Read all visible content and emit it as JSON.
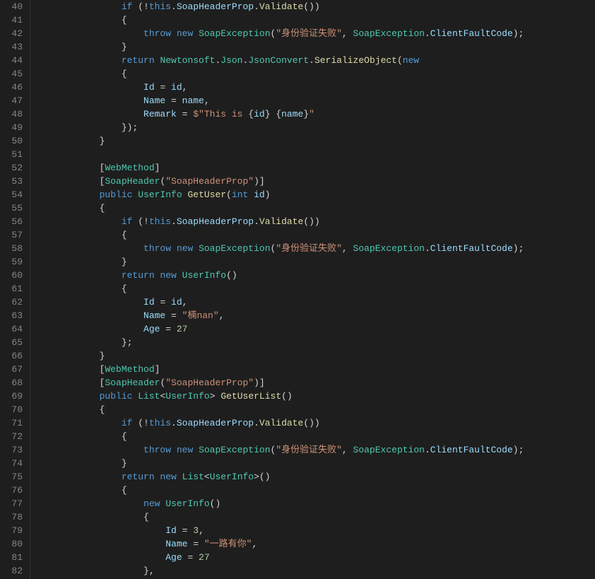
{
  "gutter": {
    "start": 40,
    "end": 82
  },
  "code": {
    "lines": [
      {
        "indent": 3,
        "segments": [
          {
            "c": "kw",
            "t": "if"
          },
          {
            "c": "pn",
            "t": " (!"
          },
          {
            "c": "kw",
            "t": "this"
          },
          {
            "c": "pn",
            "t": "."
          },
          {
            "c": "id",
            "t": "SoapHeaderProp"
          },
          {
            "c": "pn",
            "t": "."
          },
          {
            "c": "fn",
            "t": "Validate"
          },
          {
            "c": "pn",
            "t": "())"
          }
        ]
      },
      {
        "indent": 3,
        "segments": [
          {
            "c": "pn",
            "t": "{"
          }
        ]
      },
      {
        "indent": 4,
        "segments": [
          {
            "c": "kw",
            "t": "throw"
          },
          {
            "c": "pn",
            "t": " "
          },
          {
            "c": "kw",
            "t": "new"
          },
          {
            "c": "pn",
            "t": " "
          },
          {
            "c": "type",
            "t": "SoapException"
          },
          {
            "c": "pn",
            "t": "("
          },
          {
            "c": "str",
            "t": "\"身份验证失败\""
          },
          {
            "c": "pn",
            "t": ", "
          },
          {
            "c": "type",
            "t": "SoapException"
          },
          {
            "c": "pn",
            "t": "."
          },
          {
            "c": "id",
            "t": "ClientFaultCode"
          },
          {
            "c": "pn",
            "t": ");"
          }
        ]
      },
      {
        "indent": 3,
        "segments": [
          {
            "c": "pn",
            "t": "}"
          }
        ]
      },
      {
        "indent": 3,
        "segments": [
          {
            "c": "kw",
            "t": "return"
          },
          {
            "c": "pn",
            "t": " "
          },
          {
            "c": "type",
            "t": "Newtonsoft"
          },
          {
            "c": "pn",
            "t": "."
          },
          {
            "c": "type",
            "t": "Json"
          },
          {
            "c": "pn",
            "t": "."
          },
          {
            "c": "type",
            "t": "JsonConvert"
          },
          {
            "c": "pn",
            "t": "."
          },
          {
            "c": "fn",
            "t": "SerializeObject"
          },
          {
            "c": "pn",
            "t": "("
          },
          {
            "c": "kw",
            "t": "new"
          }
        ]
      },
      {
        "indent": 3,
        "segments": [
          {
            "c": "pn",
            "t": "{"
          }
        ]
      },
      {
        "indent": 4,
        "segments": [
          {
            "c": "id",
            "t": "Id"
          },
          {
            "c": "pn",
            "t": " = "
          },
          {
            "c": "id",
            "t": "id"
          },
          {
            "c": "pn",
            "t": ","
          }
        ]
      },
      {
        "indent": 4,
        "segments": [
          {
            "c": "id",
            "t": "Name"
          },
          {
            "c": "pn",
            "t": " = "
          },
          {
            "c": "id",
            "t": "name"
          },
          {
            "c": "pn",
            "t": ","
          }
        ]
      },
      {
        "indent": 4,
        "segments": [
          {
            "c": "id",
            "t": "Remark"
          },
          {
            "c": "pn",
            "t": " = "
          },
          {
            "c": "str",
            "t": "$\"This is "
          },
          {
            "c": "pn",
            "t": "{"
          },
          {
            "c": "id",
            "t": "id"
          },
          {
            "c": "pn",
            "t": "}"
          },
          {
            "c": "str",
            "t": " "
          },
          {
            "c": "pn",
            "t": "{"
          },
          {
            "c": "id",
            "t": "name"
          },
          {
            "c": "pn",
            "t": "}"
          },
          {
            "c": "str",
            "t": "\""
          }
        ]
      },
      {
        "indent": 3,
        "segments": [
          {
            "c": "pn",
            "t": "});"
          }
        ]
      },
      {
        "indent": 2,
        "segments": [
          {
            "c": "pn",
            "t": "}"
          }
        ]
      },
      {
        "indent": 0,
        "segments": []
      },
      {
        "indent": 2,
        "segments": [
          {
            "c": "pn",
            "t": "["
          },
          {
            "c": "type",
            "t": "WebMethod"
          },
          {
            "c": "pn",
            "t": "]"
          }
        ]
      },
      {
        "indent": 2,
        "segments": [
          {
            "c": "pn",
            "t": "["
          },
          {
            "c": "type",
            "t": "SoapHeader"
          },
          {
            "c": "pn",
            "t": "("
          },
          {
            "c": "str",
            "t": "\"SoapHeaderProp\""
          },
          {
            "c": "pn",
            "t": ")]"
          }
        ]
      },
      {
        "indent": 2,
        "segments": [
          {
            "c": "kw",
            "t": "public"
          },
          {
            "c": "pn",
            "t": " "
          },
          {
            "c": "type",
            "t": "UserInfo"
          },
          {
            "c": "pn",
            "t": " "
          },
          {
            "c": "fn",
            "t": "GetUser"
          },
          {
            "c": "pn",
            "t": "("
          },
          {
            "c": "kw",
            "t": "int"
          },
          {
            "c": "pn",
            "t": " "
          },
          {
            "c": "id",
            "t": "id"
          },
          {
            "c": "pn",
            "t": ")"
          }
        ]
      },
      {
        "indent": 2,
        "segments": [
          {
            "c": "pn",
            "t": "{"
          }
        ]
      },
      {
        "indent": 3,
        "segments": [
          {
            "c": "kw",
            "t": "if"
          },
          {
            "c": "pn",
            "t": " (!"
          },
          {
            "c": "kw",
            "t": "this"
          },
          {
            "c": "pn",
            "t": "."
          },
          {
            "c": "id",
            "t": "SoapHeaderProp"
          },
          {
            "c": "pn",
            "t": "."
          },
          {
            "c": "fn",
            "t": "Validate"
          },
          {
            "c": "pn",
            "t": "())"
          }
        ]
      },
      {
        "indent": 3,
        "segments": [
          {
            "c": "pn",
            "t": "{"
          }
        ]
      },
      {
        "indent": 4,
        "segments": [
          {
            "c": "kw",
            "t": "throw"
          },
          {
            "c": "pn",
            "t": " "
          },
          {
            "c": "kw",
            "t": "new"
          },
          {
            "c": "pn",
            "t": " "
          },
          {
            "c": "type",
            "t": "SoapException"
          },
          {
            "c": "pn",
            "t": "("
          },
          {
            "c": "str",
            "t": "\"身份验证失败\""
          },
          {
            "c": "pn",
            "t": ", "
          },
          {
            "c": "type",
            "t": "SoapException"
          },
          {
            "c": "pn",
            "t": "."
          },
          {
            "c": "id",
            "t": "ClientFaultCode"
          },
          {
            "c": "pn",
            "t": ");"
          }
        ]
      },
      {
        "indent": 3,
        "segments": [
          {
            "c": "pn",
            "t": "}"
          }
        ]
      },
      {
        "indent": 3,
        "segments": [
          {
            "c": "kw",
            "t": "return"
          },
          {
            "c": "pn",
            "t": " "
          },
          {
            "c": "kw",
            "t": "new"
          },
          {
            "c": "pn",
            "t": " "
          },
          {
            "c": "type",
            "t": "UserInfo"
          },
          {
            "c": "pn",
            "t": "()"
          }
        ]
      },
      {
        "indent": 3,
        "segments": [
          {
            "c": "pn",
            "t": "{"
          }
        ]
      },
      {
        "indent": 4,
        "segments": [
          {
            "c": "id",
            "t": "Id"
          },
          {
            "c": "pn",
            "t": " = "
          },
          {
            "c": "id",
            "t": "id"
          },
          {
            "c": "pn",
            "t": ","
          }
        ]
      },
      {
        "indent": 4,
        "segments": [
          {
            "c": "id",
            "t": "Name"
          },
          {
            "c": "pn",
            "t": " = "
          },
          {
            "c": "str",
            "t": "\"楠nan\""
          },
          {
            "c": "pn",
            "t": ","
          }
        ]
      },
      {
        "indent": 4,
        "segments": [
          {
            "c": "id",
            "t": "Age"
          },
          {
            "c": "pn",
            "t": " = "
          },
          {
            "c": "num",
            "t": "27"
          }
        ]
      },
      {
        "indent": 3,
        "segments": [
          {
            "c": "pn",
            "t": "};"
          }
        ]
      },
      {
        "indent": 2,
        "segments": [
          {
            "c": "pn",
            "t": "}"
          }
        ]
      },
      {
        "indent": 2,
        "segments": [
          {
            "c": "pn",
            "t": "["
          },
          {
            "c": "type",
            "t": "WebMethod"
          },
          {
            "c": "pn",
            "t": "]"
          }
        ]
      },
      {
        "indent": 2,
        "segments": [
          {
            "c": "pn",
            "t": "["
          },
          {
            "c": "type",
            "t": "SoapHeader"
          },
          {
            "c": "pn",
            "t": "("
          },
          {
            "c": "str",
            "t": "\"SoapHeaderProp\""
          },
          {
            "c": "pn",
            "t": ")]"
          }
        ]
      },
      {
        "indent": 2,
        "segments": [
          {
            "c": "kw",
            "t": "public"
          },
          {
            "c": "pn",
            "t": " "
          },
          {
            "c": "type",
            "t": "List"
          },
          {
            "c": "pn",
            "t": "<"
          },
          {
            "c": "type",
            "t": "UserInfo"
          },
          {
            "c": "pn",
            "t": "> "
          },
          {
            "c": "fn",
            "t": "GetUserList"
          },
          {
            "c": "pn",
            "t": "()"
          }
        ]
      },
      {
        "indent": 2,
        "segments": [
          {
            "c": "pn",
            "t": "{"
          }
        ]
      },
      {
        "indent": 3,
        "segments": [
          {
            "c": "kw",
            "t": "if"
          },
          {
            "c": "pn",
            "t": " (!"
          },
          {
            "c": "kw",
            "t": "this"
          },
          {
            "c": "pn",
            "t": "."
          },
          {
            "c": "id",
            "t": "SoapHeaderProp"
          },
          {
            "c": "pn",
            "t": "."
          },
          {
            "c": "fn",
            "t": "Validate"
          },
          {
            "c": "pn",
            "t": "())"
          }
        ]
      },
      {
        "indent": 3,
        "segments": [
          {
            "c": "pn",
            "t": "{"
          }
        ]
      },
      {
        "indent": 4,
        "segments": [
          {
            "c": "kw",
            "t": "throw"
          },
          {
            "c": "pn",
            "t": " "
          },
          {
            "c": "kw",
            "t": "new"
          },
          {
            "c": "pn",
            "t": " "
          },
          {
            "c": "type",
            "t": "SoapException"
          },
          {
            "c": "pn",
            "t": "("
          },
          {
            "c": "str",
            "t": "\"身份验证失败\""
          },
          {
            "c": "pn",
            "t": ", "
          },
          {
            "c": "type",
            "t": "SoapException"
          },
          {
            "c": "pn",
            "t": "."
          },
          {
            "c": "id",
            "t": "ClientFaultCode"
          },
          {
            "c": "pn",
            "t": ");"
          }
        ]
      },
      {
        "indent": 3,
        "segments": [
          {
            "c": "pn",
            "t": "}"
          }
        ]
      },
      {
        "indent": 3,
        "segments": [
          {
            "c": "kw",
            "t": "return"
          },
          {
            "c": "pn",
            "t": " "
          },
          {
            "c": "kw",
            "t": "new"
          },
          {
            "c": "pn",
            "t": " "
          },
          {
            "c": "type",
            "t": "List"
          },
          {
            "c": "pn",
            "t": "<"
          },
          {
            "c": "type",
            "t": "UserInfo"
          },
          {
            "c": "pn",
            "t": ">()"
          }
        ]
      },
      {
        "indent": 3,
        "segments": [
          {
            "c": "pn",
            "t": "{"
          }
        ]
      },
      {
        "indent": 4,
        "segments": [
          {
            "c": "kw",
            "t": "new"
          },
          {
            "c": "pn",
            "t": " "
          },
          {
            "c": "type",
            "t": "UserInfo"
          },
          {
            "c": "pn",
            "t": "()"
          }
        ]
      },
      {
        "indent": 4,
        "segments": [
          {
            "c": "pn",
            "t": "{"
          }
        ]
      },
      {
        "indent": 5,
        "segments": [
          {
            "c": "id",
            "t": "Id"
          },
          {
            "c": "pn",
            "t": " = "
          },
          {
            "c": "num",
            "t": "3"
          },
          {
            "c": "pn",
            "t": ","
          }
        ]
      },
      {
        "indent": 5,
        "segments": [
          {
            "c": "id",
            "t": "Name"
          },
          {
            "c": "pn",
            "t": " = "
          },
          {
            "c": "str",
            "t": "\"一路有你\""
          },
          {
            "c": "pn",
            "t": ","
          }
        ]
      },
      {
        "indent": 5,
        "segments": [
          {
            "c": "id",
            "t": "Age"
          },
          {
            "c": "pn",
            "t": " = "
          },
          {
            "c": "num",
            "t": "27"
          }
        ]
      },
      {
        "indent": 4,
        "segments": [
          {
            "c": "pn",
            "t": "},"
          }
        ]
      }
    ]
  },
  "indentUnit": "    ",
  "baseIndent": "    "
}
